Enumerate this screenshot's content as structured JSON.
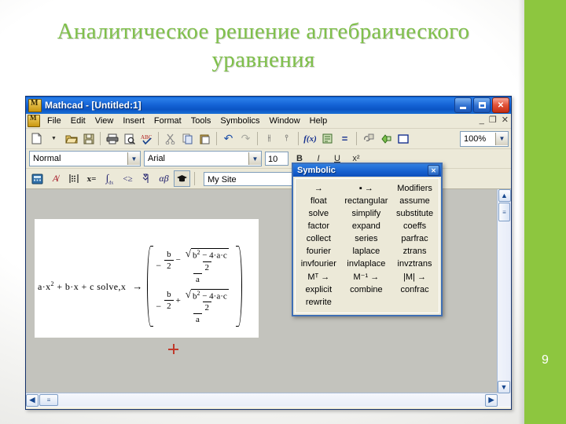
{
  "slide": {
    "title": "Аналитическое решение алгебраического уравнения",
    "number": "9",
    "accent_color": "#8dc63f",
    "title_color": "#7fc04a"
  },
  "window": {
    "title": "Mathcad - [Untitled:1]",
    "app_icon": "mathcad-icon",
    "buttons": {
      "minimize": "minimize-icon",
      "maximize": "maximize-icon",
      "close": "✕"
    },
    "mdi_buttons": {
      "minimize": "_",
      "restore": "❐",
      "close": "✕"
    }
  },
  "menubar": {
    "items": [
      {
        "label": "File"
      },
      {
        "label": "Edit"
      },
      {
        "label": "View"
      },
      {
        "label": "Insert"
      },
      {
        "label": "Format"
      },
      {
        "label": "Tools"
      },
      {
        "label": "Symbolics"
      },
      {
        "label": "Window"
      },
      {
        "label": "Help"
      }
    ]
  },
  "standard_toolbar": {
    "zoom_value": "100%",
    "buttons": [
      {
        "name": "new-document-button",
        "glyph": "🗋"
      },
      {
        "name": "new-dropdown-button",
        "glyph": "▾"
      },
      {
        "name": "open-button",
        "glyph": "📂"
      },
      {
        "name": "save-button",
        "glyph": "💾"
      },
      {
        "name": "print-button",
        "glyph": "🖨"
      },
      {
        "name": "print-preview-button",
        "glyph": "🔍"
      },
      {
        "name": "spell-check-button",
        "glyph": "ABC"
      },
      {
        "name": "cut-button",
        "glyph": "✂"
      },
      {
        "name": "copy-button",
        "glyph": "⧉"
      },
      {
        "name": "paste-button",
        "glyph": "📋"
      },
      {
        "name": "undo-button",
        "glyph": "↶"
      },
      {
        "name": "redo-button",
        "glyph": "↷"
      },
      {
        "name": "align-across-button",
        "glyph": "⊣⊢"
      },
      {
        "name": "align-down-button",
        "glyph": "⊤"
      },
      {
        "name": "insert-function-button",
        "glyph": "f(x)"
      },
      {
        "name": "insert-unit-button",
        "glyph": "🗒"
      },
      {
        "name": "calculate-button",
        "glyph": "="
      },
      {
        "name": "insert-hyperlink-button",
        "glyph": "🔗"
      },
      {
        "name": "insert-component-button",
        "glyph": "🧩"
      },
      {
        "name": "insert-area-button",
        "glyph": "▭"
      }
    ]
  },
  "format_toolbar": {
    "style": "Normal",
    "font": "Arial",
    "size": "10",
    "buttons": [
      {
        "name": "bold-button",
        "glyph": "B"
      },
      {
        "name": "italic-button",
        "glyph": "I"
      },
      {
        "name": "underline-button",
        "glyph": "U"
      },
      {
        "name": "align-left-button",
        "glyph": "≡"
      },
      {
        "name": "align-center-button",
        "glyph": "≡"
      },
      {
        "name": "align-right-button",
        "glyph": "≡"
      },
      {
        "name": "bullet-list-button",
        "glyph": "•≡"
      },
      {
        "name": "superscript-button",
        "glyph": "x²"
      }
    ]
  },
  "math_toolbar": {
    "site_value": "My Site",
    "buttons": [
      {
        "name": "calculator-palette-button",
        "glyph": "🖩"
      },
      {
        "name": "graph-palette-button",
        "glyph": "A⃒"
      },
      {
        "name": "matrix-palette-button",
        "glyph": "⋮⋮⋮"
      },
      {
        "name": "evaluation-palette-button",
        "glyph": "x="
      },
      {
        "name": "calculus-palette-button",
        "glyph": "∫"
      },
      {
        "name": "boolean-palette-button",
        "glyph": "<≥"
      },
      {
        "name": "programming-palette-button",
        "glyph": "♦⌐"
      },
      {
        "name": "greek-palette-button",
        "glyph": "αβ"
      },
      {
        "name": "symbolic-palette-button",
        "glyph": "🎓"
      }
    ]
  },
  "symbolic_palette": {
    "title": "Symbolic",
    "close_glyph": "✕",
    "rows": [
      [
        "→",
        "▪ →",
        "Modifiers"
      ],
      [
        "float",
        "rectangular",
        "assume"
      ],
      [
        "solve",
        "simplify",
        "substitute"
      ],
      [
        "factor",
        "expand",
        "coeffs"
      ],
      [
        "collect",
        "series",
        "parfrac"
      ],
      [
        "fourier",
        "laplace",
        "ztrans"
      ],
      [
        "invfourier",
        "invlaplace",
        "invztrans"
      ],
      [
        "Mᵀ →",
        "M⁻¹ →",
        "|M| →"
      ],
      [
        "explicit",
        "combine",
        "confrac"
      ],
      [
        "rewrite",
        "",
        ""
      ]
    ]
  },
  "worksheet": {
    "expression": {
      "lhs_prefix": "a·x",
      "lhs_power": "2",
      "lhs_rest": " + b·x + c solve,x",
      "arrow": "→",
      "results": [
        {
          "sign": "−",
          "numerator_left_num": "b",
          "numerator_left_den": "2",
          "operator": "−",
          "sqrt_radicand_base": "b",
          "sqrt_radicand_power": "2",
          "sqrt_radicand_rest": " − 4·a·c",
          "sqrt_den": "2",
          "denominator": "a"
        },
        {
          "sign": "−",
          "numerator_left_num": "b",
          "numerator_left_den": "2",
          "operator": "+",
          "sqrt_radicand_base": "b",
          "sqrt_radicand_power": "2",
          "sqrt_radicand_rest": " − 4·a·c",
          "sqrt_den": "2",
          "denominator": "a"
        }
      ]
    },
    "cursor": "crosshair-cursor"
  },
  "scrollbars": {
    "v_up": "▲",
    "v_down": "▼",
    "h_left": "◀",
    "h_right": "▶",
    "thumb": "≡"
  }
}
